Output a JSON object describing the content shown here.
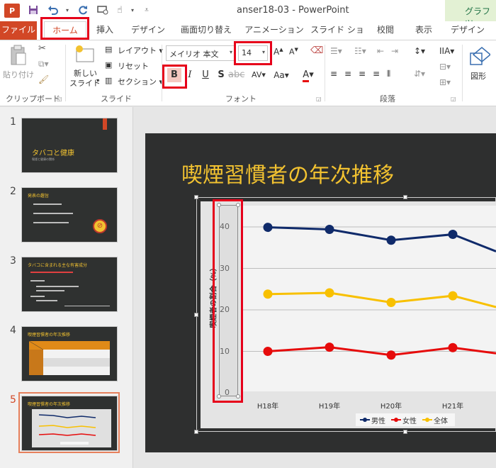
{
  "titlebar": {
    "app_icon_label": "P",
    "window_title": "anser18-03 - PowerPoint",
    "contextual_tab": "グラフ ツ"
  },
  "ribbon": {
    "tabs": [
      {
        "label": "ファイル"
      },
      {
        "label": "ホーム"
      },
      {
        "label": "挿入"
      },
      {
        "label": "デザイン"
      },
      {
        "label": "画面切り替え"
      },
      {
        "label": "アニメーション"
      },
      {
        "label": "スライド ショー"
      },
      {
        "label": "校閲"
      },
      {
        "label": "表示"
      },
      {
        "label": "デザイン"
      }
    ],
    "groups": {
      "clipboard": {
        "label": "クリップボード",
        "paste": "貼り付け"
      },
      "slides": {
        "label": "スライド",
        "new_slide_line1": "新しい",
        "new_slide_line2": "スライド",
        "layout": "レイアウト",
        "reset": "リセット",
        "section": "セクション"
      },
      "font": {
        "label": "フォント",
        "font_name": "メイリオ 本文",
        "font_size": "14",
        "bold": "B",
        "italic": "I",
        "underline": "U",
        "shadow": "S",
        "spacing": "AV",
        "case": "Aa",
        "color": "A"
      },
      "paragraph": {
        "label": "段落"
      },
      "drawing": {
        "shape": "図形"
      }
    }
  },
  "slides": [
    {
      "number": "1",
      "title": "タバコと健康",
      "subtitle": "喫煙と健康の関係"
    },
    {
      "number": "2",
      "title": "発表の趣旨"
    },
    {
      "number": "3",
      "title": "タバコに含まれる主な有害成分"
    },
    {
      "number": "4",
      "title": "喫煙習慣者の年次推移"
    },
    {
      "number": "5",
      "title": "喫煙習慣者の年次推移"
    }
  ],
  "current_slide": {
    "title": "喫煙習慣者の年次推移"
  },
  "colors": {
    "accent": "#d24726",
    "highlight_box": "#e6001a",
    "slide_title": "#f2c230",
    "male": "#0f2a6a",
    "female": "#e60b0b",
    "total": "#f8c000"
  },
  "chart_data": {
    "type": "line",
    "categories": [
      "H18年",
      "H19年",
      "H20年",
      "H21年"
    ],
    "series": [
      {
        "name": "男性",
        "values": [
          39.9,
          39.4,
          36.8,
          38.2
        ]
      },
      {
        "name": "女性",
        "values": [
          10.0,
          11.0,
          9.1,
          10.9
        ]
      },
      {
        "name": "全体",
        "values": [
          23.8,
          24.1,
          21.8,
          23.4
        ]
      }
    ],
    "ylabel": "喫煙者の割合（%）",
    "yticks": [
      "0",
      "10",
      "20",
      "30",
      "40"
    ],
    "ylim": [
      0,
      45
    ],
    "grid": true,
    "legend": "bottom"
  }
}
